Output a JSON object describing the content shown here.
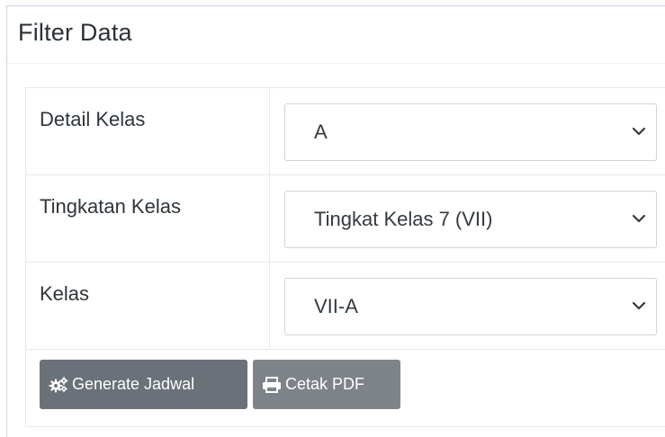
{
  "card": {
    "title": "Filter Data"
  },
  "fields": [
    {
      "label": "Detail Kelas",
      "value": "A"
    },
    {
      "label": "Tingkatan Kelas",
      "value": "Tingkat Kelas 7 (VII)"
    },
    {
      "label": "Kelas",
      "value": "VII-A"
    }
  ],
  "actions": {
    "generate_label": "Generate Jadwal",
    "generate_icon": "cogs-icon",
    "pdf_label": "Cetak PDF",
    "pdf_icon": "printer-icon"
  },
  "colors": {
    "button_bg": "#6c757d",
    "button_text": "#ffffff",
    "border": "#ced4da"
  }
}
